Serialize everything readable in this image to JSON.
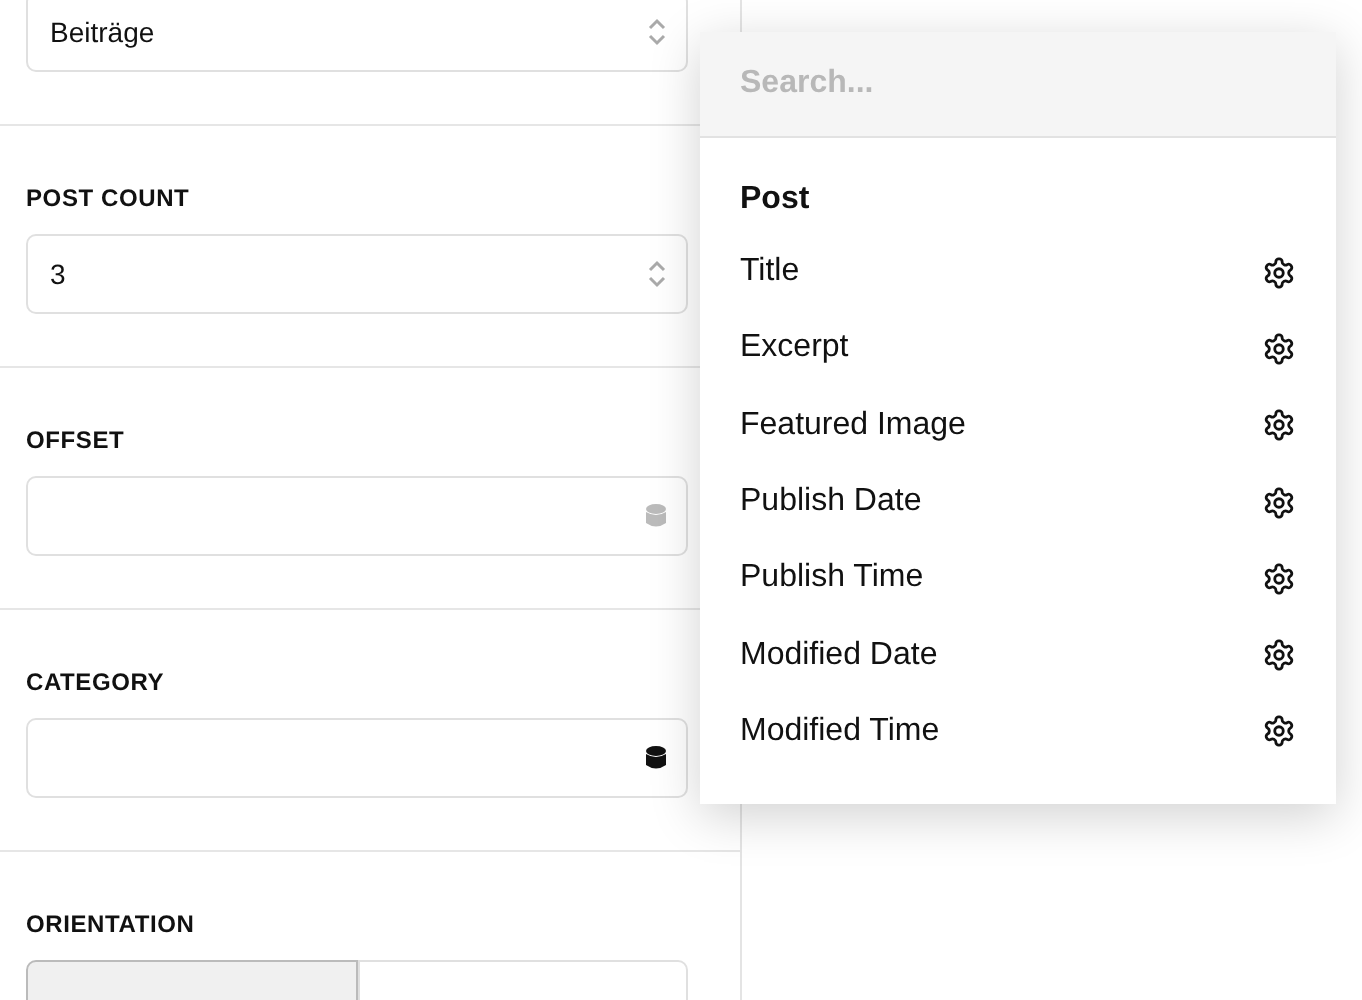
{
  "panel": {
    "sections": [
      {
        "kind": "select",
        "value": "Beiträge"
      },
      {
        "kind": "select",
        "label": "POST COUNT",
        "value": "3"
      },
      {
        "kind": "dynamic",
        "label": "OFFSET",
        "source_active": false
      },
      {
        "kind": "dynamic",
        "label": "CATEGORY",
        "source_active": true
      },
      {
        "kind": "segments",
        "label": "ORIENTATION",
        "segments": [
          {
            "selected": true
          },
          {
            "selected": false
          }
        ]
      }
    ]
  },
  "dropdown": {
    "search": {
      "placeholder": "Search..."
    },
    "group": "Post",
    "items": [
      "Title",
      "Excerpt",
      "Featured Image",
      "Publish Date",
      "Publish Time",
      "Modified Date",
      "Modified Time"
    ]
  }
}
